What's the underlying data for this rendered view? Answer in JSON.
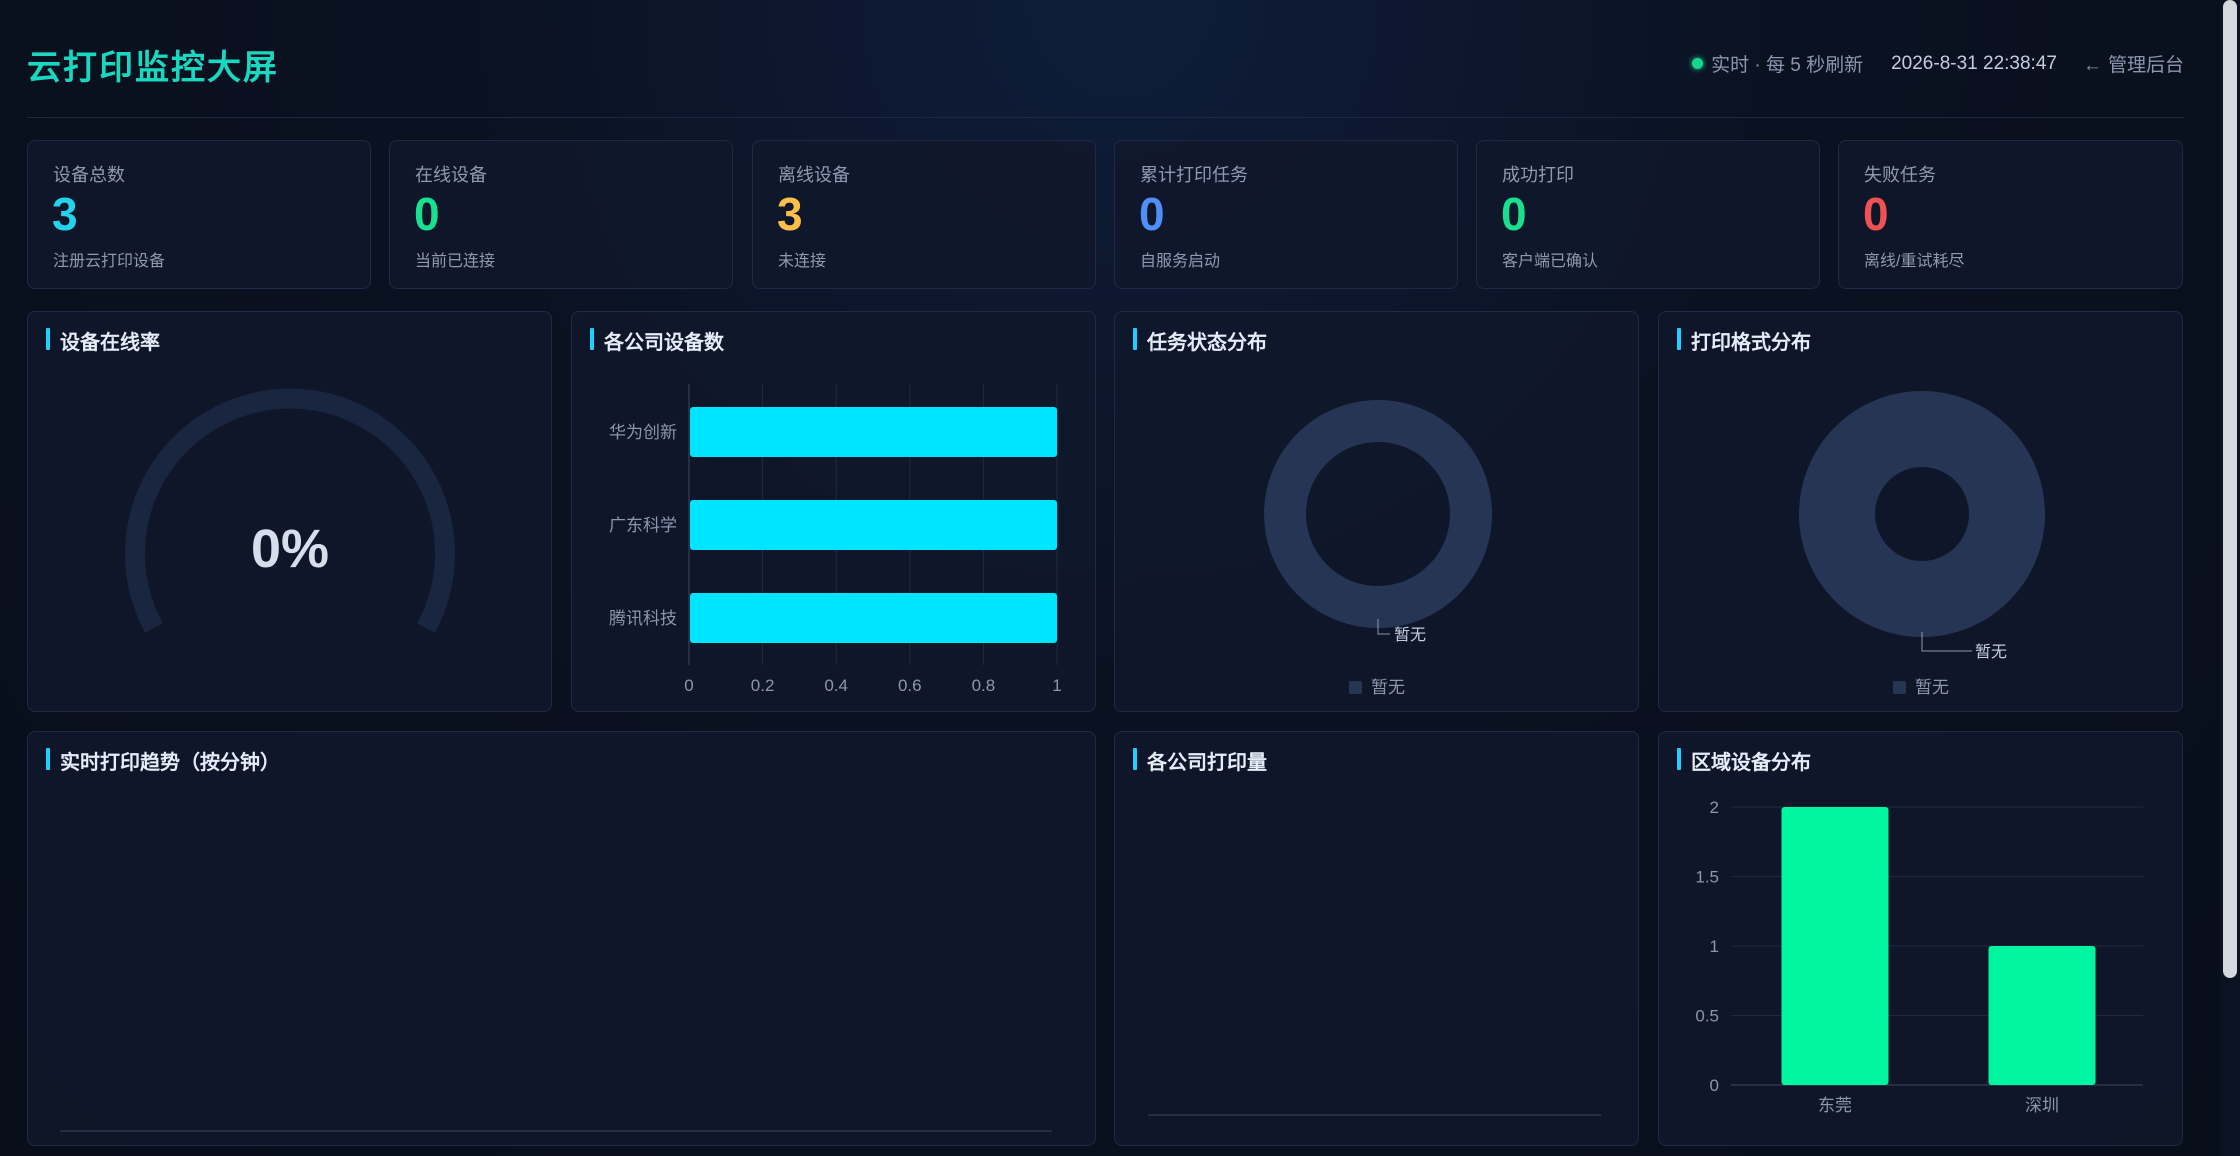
{
  "header": {
    "title": "云打印监控大屏",
    "live_text": "实时 · 每 5 秒刷新",
    "datetime": "2026-8-31 22:38:47",
    "admin_arrow": "←",
    "admin_label": "管理后台"
  },
  "stats": [
    {
      "label": "设备总数",
      "value": "3",
      "sub": "注册云打印设备",
      "color": "#22d3ee"
    },
    {
      "label": "在线设备",
      "value": "0",
      "sub": "当前已连接",
      "color": "#19e08e"
    },
    {
      "label": "离线设备",
      "value": "3",
      "sub": "未连接",
      "color": "#fbbf4a"
    },
    {
      "label": "累计打印任务",
      "value": "0",
      "sub": "自服务启动",
      "color": "#4f8ff7"
    },
    {
      "label": "成功打印",
      "value": "0",
      "sub": "客户端已确认",
      "color": "#19e08e"
    },
    {
      "label": "失败任务",
      "value": "0",
      "sub": "离线/重试耗尽",
      "color": "#f05252"
    }
  ],
  "panels": {
    "online_rate": {
      "title": "设备在线率",
      "value": "0%",
      "fraction": 0
    },
    "company_devices": {
      "title": "各公司设备数"
    },
    "task_status": {
      "title": "任务状态分布",
      "empty_label": "暂无",
      "legend": "暂无"
    },
    "print_format": {
      "title": "打印格式分布",
      "empty_label": "暂无",
      "legend": "暂无"
    },
    "trend": {
      "title": "实时打印趋势（按分钟）"
    },
    "company_prints": {
      "title": "各公司打印量"
    },
    "region": {
      "title": "区域设备分布"
    }
  },
  "colors": {
    "bar_cyan": "#00e5ff",
    "bar_green": "#00f5a0",
    "donut_empty": "#253553",
    "gauge_track": "#1a2540"
  },
  "chart_data": [
    {
      "type": "bar",
      "orientation": "horizontal",
      "categories": [
        "华为创新",
        "广东科学",
        "腾讯科技"
      ],
      "values": [
        1,
        1,
        1
      ],
      "xlim": [
        0,
        1
      ],
      "xticks": [
        "0",
        "0.2",
        "0.4",
        "0.6",
        "0.8",
        "1"
      ]
    },
    {
      "type": "bar",
      "categories": [
        "东莞",
        "深圳"
      ],
      "values": [
        2,
        1
      ],
      "ylim": [
        0,
        2
      ],
      "yticks": [
        "0",
        "0.5",
        "1",
        "1.5",
        "2"
      ]
    }
  ]
}
